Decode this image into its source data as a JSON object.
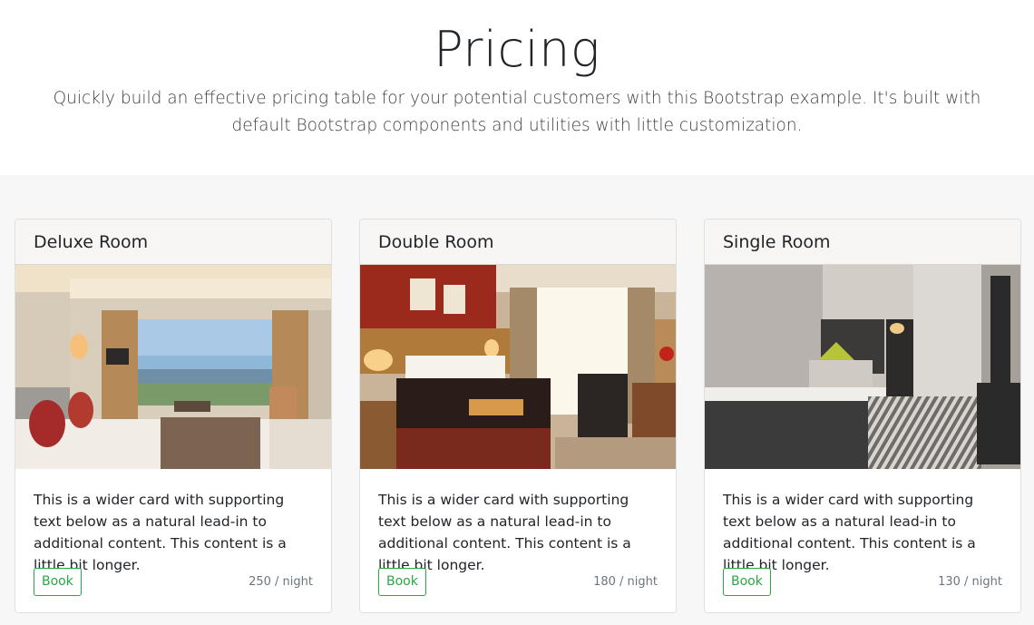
{
  "hero": {
    "title": "Pricing",
    "lead": "Quickly build an effective pricing table for your potential customers with this Bootstrap example. It's built with default Bootstrap components and utilities with little customization."
  },
  "cards": [
    {
      "title": "Deluxe Room",
      "text": "This is a wider card with supporting text below as a natural lead-in to additional content. This content is a little bit longer.",
      "button": "Book",
      "price": "250 / night"
    },
    {
      "title": "Double Room",
      "text": "This is a wider card with supporting text below as a natural lead-in to additional content. This content is a little bit longer.",
      "button": "Book",
      "price": "180 / night"
    },
    {
      "title": "Single Room",
      "text": "This is a wider card with supporting text below as a natural lead-in to additional content. This content is a little bit longer.",
      "button": "Book",
      "price": "130 / night"
    }
  ],
  "colors": {
    "accent": "#28a745",
    "section_bg": "#f7f7f7",
    "muted": "#6c757d"
  }
}
